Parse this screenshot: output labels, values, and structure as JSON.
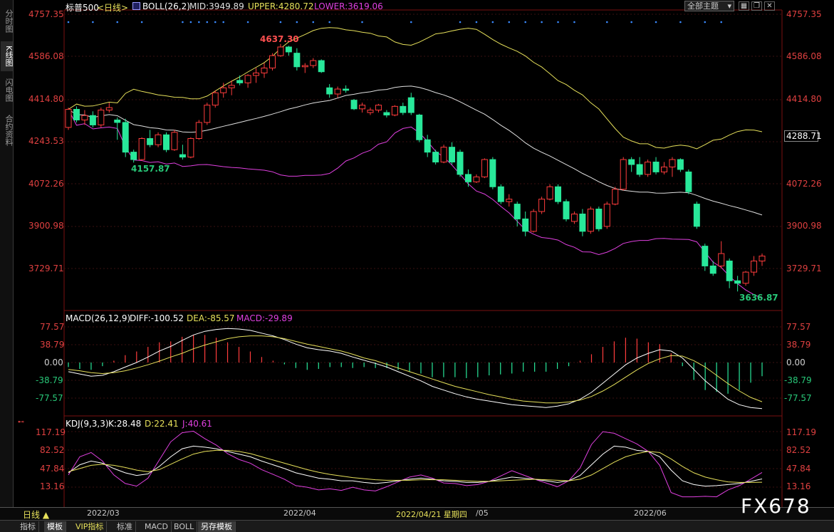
{
  "left_rail": [
    "分时图",
    "K线图",
    "闪电图",
    "合约资料"
  ],
  "header": {
    "symbol": "标普500",
    "period": "<日线>",
    "boll_name": "BOLL(26,2)",
    "mid": "MID:3949.89",
    "upper": "UPPER:4280.72",
    "lower": "LOWER:3619.06",
    "dropdown": "全部主题",
    "colors": {
      "mid": "#e0e0e0",
      "upper": "#e6e05a",
      "lower": "#e040e0"
    }
  },
  "price_axis": [
    "4757.35",
    "4586.08",
    "4414.80",
    "4243.53",
    "4072.26",
    "3900.98",
    "3729.71"
  ],
  "price_axis_right_last": "4288.71",
  "annotations": {
    "high": "4637.30",
    "low1": "4157.87",
    "low2": "3636.87"
  },
  "macd": {
    "title": "MACD(26,12,9)",
    "diff": "DIFF:-100.52",
    "dea": "DEA:-85.57",
    "macd": "MACD:-29.89",
    "axis": [
      "77.57",
      "38.79",
      "0.00",
      "-38.79",
      "-77.57"
    ]
  },
  "kdj": {
    "title": "KDJ(9,3,3)",
    "k": "K:28.48",
    "d": "D:22.41",
    "j": "J:40.61",
    "axis": [
      "117.19",
      "82.52",
      "47.84",
      "13.16"
    ]
  },
  "x_axis": {
    "period_button": "日线 ▲",
    "dates": [
      "2022/03",
      "2022/04",
      "2022/04/21 星期四",
      "/05",
      "2022/06"
    ]
  },
  "tabs": [
    "指标",
    "模板",
    "VIP指标",
    "标准",
    "MACD",
    "BOLL",
    "另存模板"
  ],
  "watermark": "FX678",
  "chart_data": [
    {
      "type": "candlestick",
      "title": "标普500",
      "ylim": [
        3636.87,
        4757.35
      ],
      "candles": [
        [
          4300,
          4380,
          4290,
          4373
        ],
        [
          4373,
          4385,
          4320,
          4330
        ],
        [
          4330,
          4370,
          4310,
          4348
        ],
        [
          4348,
          4365,
          4300,
          4310
        ],
        [
          4310,
          4380,
          4300,
          4370
        ],
        [
          4370,
          4400,
          4360,
          4380
        ],
        [
          4330,
          4340,
          4250,
          4320
        ],
        [
          4320,
          4335,
          4180,
          4200
        ],
        [
          4200,
          4210,
          4157.87,
          4170
        ],
        [
          4170,
          4260,
          4165,
          4255
        ],
        [
          4255,
          4290,
          4220,
          4230
        ],
        [
          4230,
          4280,
          4220,
          4270
        ],
        [
          4270,
          4280,
          4200,
          4210
        ],
        [
          4210,
          4290,
          4205,
          4280
        ],
        [
          4190,
          4230,
          4170,
          4180
        ],
        [
          4180,
          4260,
          4175,
          4255
        ],
        [
          4255,
          4330,
          4250,
          4320
        ],
        [
          4320,
          4400,
          4310,
          4390
        ],
        [
          4390,
          4450,
          4380,
          4440
        ],
        [
          4440,
          4480,
          4420,
          4460
        ],
        [
          4460,
          4490,
          4430,
          4470
        ],
        [
          4490,
          4510,
          4470,
          4480
        ],
        [
          4480,
          4515,
          4460,
          4510
        ],
        [
          4510,
          4540,
          4480,
          4520
        ],
        [
          4520,
          4560,
          4500,
          4540
        ],
        [
          4540,
          4600,
          4530,
          4590
        ],
        [
          4590,
          4637.3,
          4585,
          4625
        ],
        [
          4625,
          4630,
          4590,
          4605
        ],
        [
          4600,
          4620,
          4530,
          4545
        ],
        [
          4545,
          4560,
          4520,
          4550
        ],
        [
          4550,
          4580,
          4540,
          4570
        ],
        [
          4570,
          4575,
          4520,
          4525
        ],
        [
          4460,
          4475,
          4420,
          4435
        ],
        [
          4435,
          4465,
          4420,
          4455
        ],
        [
          4455,
          4470,
          4440,
          4450
        ],
        [
          4410,
          4415,
          4370,
          4375
        ],
        [
          4375,
          4400,
          4360,
          4390
        ],
        [
          4360,
          4380,
          4350,
          4370
        ],
        [
          4370,
          4395,
          4360,
          4390
        ],
        [
          4360,
          4370,
          4340,
          4350
        ],
        [
          4350,
          4390,
          4345,
          4385
        ],
        [
          4385,
          4400,
          4350,
          4360
        ],
        [
          4420,
          4440,
          4350,
          4360
        ],
        [
          4350,
          4355,
          4240,
          4250
        ],
        [
          4250,
          4270,
          4180,
          4200
        ],
        [
          4200,
          4210,
          4150,
          4160
        ],
        [
          4160,
          4230,
          4155,
          4220
        ],
        [
          4220,
          4240,
          4150,
          4160
        ],
        [
          4200,
          4210,
          4100,
          4110
        ],
        [
          4110,
          4130,
          4060,
          4080
        ],
        [
          4080,
          4110,
          4075,
          4100
        ],
        [
          4100,
          4175,
          4095,
          4170
        ],
        [
          4170,
          4180,
          4050,
          4060
        ],
        [
          4060,
          4070,
          3990,
          4000
        ],
        [
          4000,
          4030,
          3980,
          4010
        ],
        [
          3990,
          4000,
          3900,
          3930
        ],
        [
          3930,
          3960,
          3860,
          3880
        ],
        [
          3880,
          3970,
          3875,
          3960
        ],
        [
          3960,
          4020,
          3950,
          4010
        ],
        [
          4010,
          4070,
          4005,
          4060
        ],
        [
          4060,
          4070,
          3990,
          4000
        ],
        [
          4000,
          4010,
          3920,
          3930
        ],
        [
          3920,
          3960,
          3910,
          3950
        ],
        [
          3950,
          3970,
          3860,
          3880
        ],
        [
          3880,
          3980,
          3870,
          3970
        ],
        [
          3970,
          3980,
          3880,
          3890
        ],
        [
          3900,
          4000,
          3890,
          3990
        ],
        [
          3990,
          4060,
          3985,
          4050
        ],
        [
          4050,
          4180,
          4045,
          4170
        ],
        [
          4170,
          4180,
          4120,
          4150
        ],
        [
          4150,
          4180,
          4100,
          4110
        ],
        [
          4110,
          4170,
          4100,
          4160
        ],
        [
          4160,
          4180,
          4110,
          4120
        ],
        [
          4120,
          4160,
          4110,
          4140
        ],
        [
          4140,
          4180,
          4100,
          4170
        ],
        [
          4170,
          4175,
          4120,
          4130
        ],
        [
          4120,
          4130,
          4030,
          4040
        ],
        [
          3990,
          4000,
          3890,
          3900
        ],
        [
          3820,
          3830,
          3720,
          3740
        ],
        [
          3740,
          3760,
          3700,
          3710
        ],
        [
          3740,
          3840,
          3730,
          3790
        ],
        [
          3760,
          3770,
          3650,
          3680
        ],
        [
          3680,
          3700,
          3636.87,
          3670
        ],
        [
          3670,
          3720,
          3660,
          3715
        ],
        [
          3715,
          3780,
          3700,
          3760
        ],
        [
          3760,
          3790,
          3740,
          3780
        ]
      ]
    },
    {
      "type": "line",
      "title": "MACD(26,12,9)",
      "ylim": [
        -100.52,
        77.57
      ],
      "series": [
        {
          "name": "DIFF",
          "values": [
            -20,
            -25,
            -30,
            -28,
            -20,
            -10,
            0,
            12,
            25,
            35,
            48,
            60,
            68,
            72,
            74,
            73,
            70,
            64,
            58,
            50,
            40,
            32,
            28,
            25,
            20,
            12,
            5,
            -2,
            -10,
            -20,
            -30,
            -40,
            -52,
            -60,
            -68,
            -75,
            -80,
            -84,
            -88,
            -92,
            -94,
            -96,
            -98,
            -95,
            -90,
            -80,
            -65,
            -45,
            -25,
            -5,
            10,
            20,
            28,
            25,
            10,
            -15,
            -40,
            -60,
            -80,
            -92,
            -98,
            -100.52
          ]
        },
        {
          "name": "DEA",
          "values": [
            -15,
            -18,
            -22,
            -24,
            -22,
            -18,
            -12,
            -5,
            3,
            12,
            20,
            30,
            38,
            45,
            52,
            56,
            58,
            58,
            56,
            52,
            46,
            40,
            35,
            30,
            25,
            18,
            10,
            4,
            -4,
            -12,
            -20,
            -28,
            -36,
            -44,
            -52,
            -58,
            -64,
            -70,
            -75,
            -80,
            -84,
            -86,
            -88,
            -88,
            -86,
            -82,
            -74,
            -62,
            -48,
            -32,
            -16,
            -2,
            8,
            15,
            14,
            4,
            -10,
            -28,
            -46,
            -62,
            -76,
            -85.57
          ]
        },
        {
          "name": "MACD",
          "values": [
            -10,
            -14,
            -16,
            -8,
            4,
            16,
            24,
            34,
            44,
            46,
            56,
            60,
            60,
            54,
            44,
            34,
            24,
            12,
            4,
            -4,
            -12,
            -16,
            -14,
            -10,
            -10,
            -12,
            -10,
            -12,
            -12,
            -16,
            -20,
            -24,
            -32,
            -32,
            -32,
            -34,
            -32,
            -28,
            -26,
            -24,
            -20,
            -20,
            -20,
            -14,
            -8,
            4,
            18,
            34,
            46,
            54,
            52,
            44,
            40,
            20,
            -8,
            -38,
            -60,
            -64,
            -68,
            -60,
            -44,
            -29.89
          ]
        }
      ]
    },
    {
      "type": "line",
      "title": "KDJ(9,3,3)",
      "ylim": [
        0,
        117.19
      ],
      "series": [
        {
          "name": "K",
          "values": [
            40,
            55,
            62,
            58,
            48,
            40,
            35,
            38,
            52,
            70,
            85,
            90,
            88,
            85,
            80,
            75,
            70,
            62,
            55,
            48,
            40,
            35,
            30,
            28,
            25,
            25,
            22,
            20,
            22,
            25,
            28,
            30,
            28,
            25,
            24,
            22,
            22,
            24,
            28,
            32,
            30,
            28,
            25,
            22,
            25,
            35,
            55,
            75,
            90,
            88,
            82,
            80,
            70,
            45,
            25,
            18,
            15,
            16,
            18,
            20,
            24,
            28.48
          ]
        },
        {
          "name": "D",
          "values": [
            42,
            48,
            54,
            56,
            54,
            50,
            45,
            42,
            46,
            56,
            66,
            75,
            80,
            82,
            82,
            80,
            76,
            70,
            64,
            58,
            52,
            46,
            41,
            37,
            34,
            31,
            29,
            27,
            26,
            26,
            26,
            27,
            27,
            27,
            26,
            25,
            24,
            24,
            25,
            26,
            27,
            28,
            27,
            26,
            25,
            28,
            36,
            48,
            60,
            70,
            76,
            80,
            78,
            66,
            52,
            40,
            32,
            27,
            23,
            22,
            22,
            22.41
          ]
        },
        {
          "name": "J",
          "values": [
            36,
            70,
            78,
            62,
            36,
            20,
            15,
            30,
            64,
            98,
            115,
            118,
            104,
            92,
            76,
            65,
            58,
            46,
            37,
            28,
            16,
            13,
            8,
            10,
            7,
            13,
            8,
            6,
            14,
            23,
            32,
            36,
            30,
            21,
            20,
            16,
            18,
            24,
            34,
            44,
            36,
            28,
            21,
            14,
            25,
            49,
            93,
            117,
            114,
            104,
            94,
            80,
            54,
            3,
            -9,
            -7,
            -4,
            -6,
            8,
            16,
            28,
            40.61
          ]
        }
      ]
    }
  ]
}
